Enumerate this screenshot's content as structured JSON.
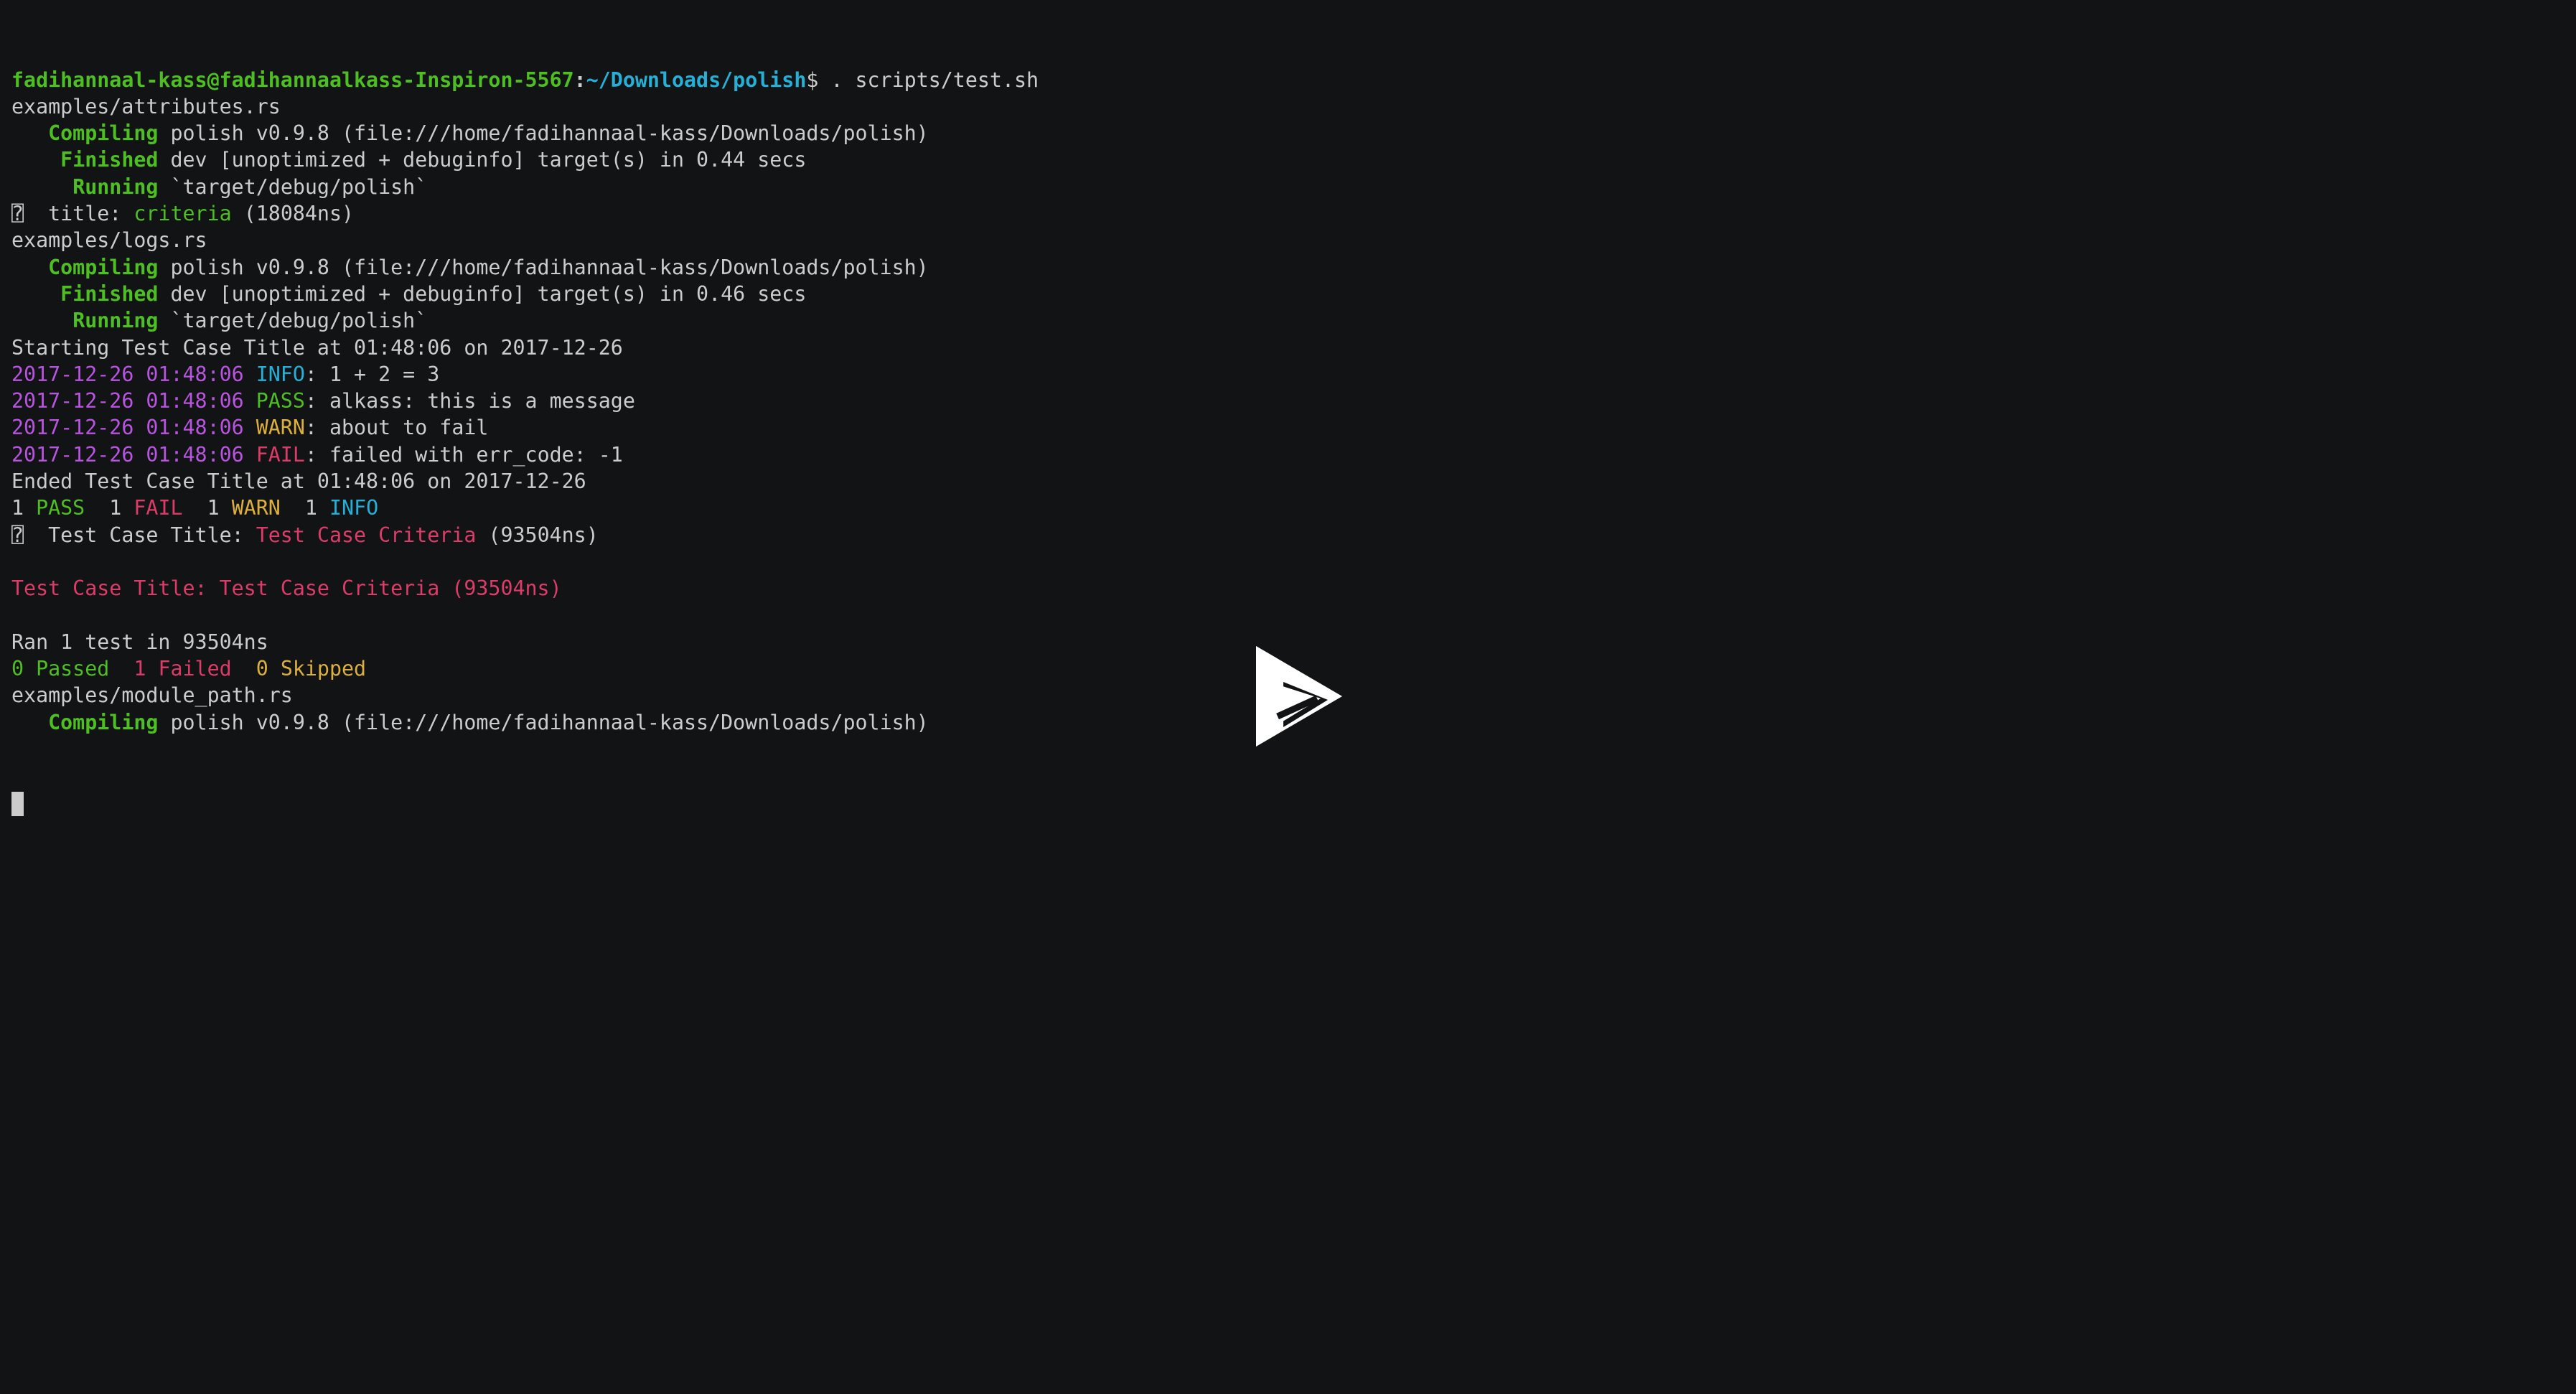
{
  "terminal": {
    "lines": [
      [
        {
          "t": "fadihannaal-kass@fadihannaalkass-Inspiron-5567",
          "c": "green-b"
        },
        {
          "t": ":",
          "c": "white-b"
        },
        {
          "t": "~/Downloads/polish",
          "c": "cyan-b"
        },
        {
          "t": "$ . scripts/test.sh",
          "c": "white"
        }
      ],
      [
        {
          "t": "examples/attributes.rs",
          "c": "white"
        }
      ],
      [
        {
          "t": "   ",
          "c": "white"
        },
        {
          "t": "Compiling",
          "c": "green-b"
        },
        {
          "t": " polish v0.9.8 (file:///home/fadihannaal-kass/Downloads/polish)",
          "c": "white"
        }
      ],
      [
        {
          "t": "    ",
          "c": "white"
        },
        {
          "t": "Finished",
          "c": "green-b"
        },
        {
          "t": " dev [unoptimized + debuginfo] target(s) in 0.44 secs",
          "c": "white"
        }
      ],
      [
        {
          "t": "     ",
          "c": "white"
        },
        {
          "t": "Running",
          "c": "green-b"
        },
        {
          "t": " `target/debug/polish`",
          "c": "white"
        }
      ],
      [
        {
          "t": "⍰  title: ",
          "c": "white"
        },
        {
          "t": "criteria",
          "c": "green"
        },
        {
          "t": " (18084ns)",
          "c": "white"
        }
      ],
      [
        {
          "t": "examples/logs.rs",
          "c": "white"
        }
      ],
      [
        {
          "t": "   ",
          "c": "white"
        },
        {
          "t": "Compiling",
          "c": "green-b"
        },
        {
          "t": " polish v0.9.8 (file:///home/fadihannaal-kass/Downloads/polish)",
          "c": "white"
        }
      ],
      [
        {
          "t": "    ",
          "c": "white"
        },
        {
          "t": "Finished",
          "c": "green-b"
        },
        {
          "t": " dev [unoptimized + debuginfo] target(s) in 0.46 secs",
          "c": "white"
        }
      ],
      [
        {
          "t": "     ",
          "c": "white"
        },
        {
          "t": "Running",
          "c": "green-b"
        },
        {
          "t": " `target/debug/polish`",
          "c": "white"
        }
      ],
      [
        {
          "t": "Starting Test Case Title at 01:48:06 on 2017-12-26",
          "c": "white"
        }
      ],
      [
        {
          "t": "2017-12-26 01:48:06 ",
          "c": "magenta"
        },
        {
          "t": "INFO",
          "c": "cyan"
        },
        {
          "t": ": 1 + 2 = 3",
          "c": "white"
        }
      ],
      [
        {
          "t": "2017-12-26 01:48:06 ",
          "c": "magenta"
        },
        {
          "t": "PASS",
          "c": "green"
        },
        {
          "t": ": alkass: this is a message",
          "c": "white"
        }
      ],
      [
        {
          "t": "2017-12-26 01:48:06 ",
          "c": "magenta"
        },
        {
          "t": "WARN",
          "c": "yellow"
        },
        {
          "t": ": about to fail",
          "c": "white"
        }
      ],
      [
        {
          "t": "2017-12-26 01:48:06 ",
          "c": "magenta"
        },
        {
          "t": "FAIL",
          "c": "red"
        },
        {
          "t": ": failed with err_code: -1",
          "c": "white"
        }
      ],
      [
        {
          "t": "Ended Test Case Title at 01:48:06 on 2017-12-26",
          "c": "white"
        }
      ],
      [
        {
          "t": "1 ",
          "c": "white"
        },
        {
          "t": "PASS",
          "c": "green"
        },
        {
          "t": "  1 ",
          "c": "white"
        },
        {
          "t": "FAIL",
          "c": "red"
        },
        {
          "t": "  1 ",
          "c": "white"
        },
        {
          "t": "WARN",
          "c": "yellow"
        },
        {
          "t": "  1 ",
          "c": "white"
        },
        {
          "t": "INFO",
          "c": "cyan"
        }
      ],
      [
        {
          "t": "⍰  Test Case Title: ",
          "c": "white"
        },
        {
          "t": "Test Case Criteria",
          "c": "red"
        },
        {
          "t": " (93504ns)",
          "c": "white"
        }
      ],
      [],
      [
        {
          "t": "Test Case Title: Test Case Criteria (93504ns)",
          "c": "red"
        }
      ],
      [],
      [
        {
          "t": "Ran 1 test in 93504ns",
          "c": "white"
        }
      ],
      [
        {
          "t": "0 Passed",
          "c": "green"
        },
        {
          "t": "  ",
          "c": "white"
        },
        {
          "t": "1 Failed",
          "c": "red"
        },
        {
          "t": "  ",
          "c": "white"
        },
        {
          "t": "0 Skipped",
          "c": "yellow"
        }
      ],
      [
        {
          "t": "examples/module_path.rs",
          "c": "white"
        }
      ],
      [
        {
          "t": "   ",
          "c": "white"
        },
        {
          "t": "Compiling",
          "c": "green-b"
        },
        {
          "t": " polish v0.9.8 (file:///home/fadihannaal-kass/Downloads/polish)",
          "c": "white"
        }
      ]
    ]
  },
  "player": {
    "play_icon": "play-icon"
  },
  "colors": {
    "background": "#121314",
    "foreground": "#cccccc",
    "green": "#4ebf22",
    "cyan": "#26b0d7",
    "magenta": "#b954e1",
    "red": "#dd3c69",
    "yellow": "#ddaf3c"
  }
}
